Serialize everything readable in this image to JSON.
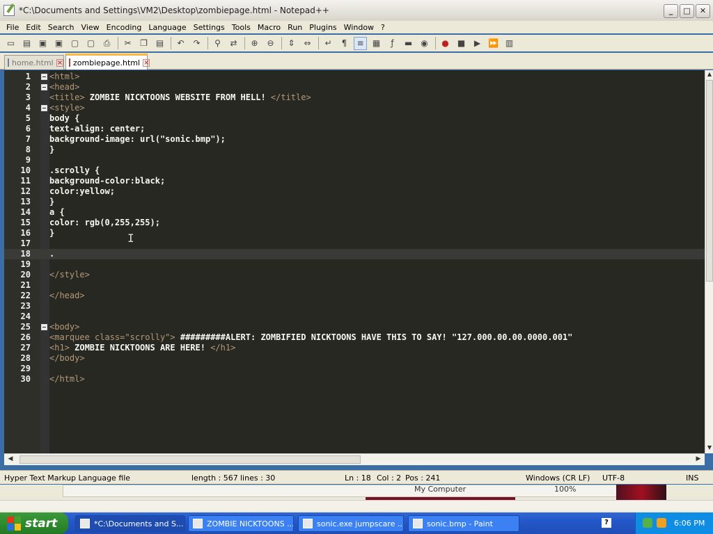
{
  "window": {
    "title": "*C:\\Documents and Settings\\VM2\\Desktop\\zombiepage.html - Notepad++"
  },
  "menu": [
    "File",
    "Edit",
    "Search",
    "View",
    "Encoding",
    "Language",
    "Settings",
    "Tools",
    "Macro",
    "Run",
    "Plugins",
    "Window",
    "?"
  ],
  "toolbar": {
    "icons": [
      "new-file-icon",
      "open-file-icon",
      "save-icon",
      "save-all-icon",
      "close-icon",
      "close-all-icon",
      "print-icon",
      "cut-icon",
      "copy-icon",
      "paste-icon",
      "undo-icon",
      "redo-icon",
      "find-icon",
      "replace-icon",
      "zoom-in-icon",
      "zoom-out-icon",
      "sync-vertical-icon",
      "sync-horizontal-icon",
      "word-wrap-icon",
      "show-all-chars-icon",
      "indent-guide-icon",
      "doc-map-icon",
      "function-list-icon",
      "folder-as-workspace-icon",
      "monitoring-icon",
      "record-macro-icon",
      "stop-macro-icon",
      "play-macro-icon",
      "run-macro-multiple-icon",
      "save-macro-icon"
    ]
  },
  "tabs": [
    {
      "label": "home.html",
      "active": false
    },
    {
      "label": "zombiepage.html",
      "active": true
    }
  ],
  "editor": {
    "current_line": 18,
    "lines": [
      {
        "n": "1",
        "fold": true,
        "parts": [
          [
            "tag",
            "<html>"
          ]
        ]
      },
      {
        "n": "2",
        "fold": true,
        "parts": [
          [
            "tag",
            "<head>"
          ]
        ]
      },
      {
        "n": "3",
        "fold": false,
        "parts": [
          [
            "tag",
            "<title>"
          ],
          [
            "txt",
            " ZOMBIE NICKTOONS WEBSITE FROM HELL! "
          ],
          [
            "tag",
            "</title>"
          ]
        ]
      },
      {
        "n": "4",
        "fold": true,
        "parts": [
          [
            "tag",
            "<style>"
          ]
        ]
      },
      {
        "n": "5",
        "fold": false,
        "parts": [
          [
            "txt",
            "body {"
          ]
        ]
      },
      {
        "n": "6",
        "fold": false,
        "parts": [
          [
            "txt",
            "text-align: center;"
          ]
        ]
      },
      {
        "n": "7",
        "fold": false,
        "parts": [
          [
            "txt",
            "background-image: url(\"sonic.bmp\");"
          ]
        ]
      },
      {
        "n": "8",
        "fold": false,
        "parts": [
          [
            "txt",
            "}"
          ]
        ]
      },
      {
        "n": "9",
        "fold": false,
        "parts": []
      },
      {
        "n": "10",
        "fold": false,
        "parts": [
          [
            "txt",
            ".scrolly {"
          ]
        ]
      },
      {
        "n": "11",
        "fold": false,
        "parts": [
          [
            "txt",
            "background-color:black;"
          ]
        ]
      },
      {
        "n": "12",
        "fold": false,
        "parts": [
          [
            "txt",
            "color:yellow;"
          ]
        ]
      },
      {
        "n": "13",
        "fold": false,
        "parts": [
          [
            "txt",
            "}"
          ]
        ]
      },
      {
        "n": "14",
        "fold": false,
        "parts": [
          [
            "txt",
            "a {"
          ]
        ]
      },
      {
        "n": "15",
        "fold": false,
        "parts": [
          [
            "txt",
            "color: rgb(0,255,255);"
          ]
        ]
      },
      {
        "n": "16",
        "fold": false,
        "parts": [
          [
            "txt",
            "}"
          ]
        ]
      },
      {
        "n": "17",
        "fold": false,
        "parts": []
      },
      {
        "n": "18",
        "fold": false,
        "parts": [
          [
            "txt",
            "."
          ]
        ]
      },
      {
        "n": "19",
        "fold": false,
        "parts": []
      },
      {
        "n": "20",
        "fold": false,
        "parts": [
          [
            "tag",
            "</style>"
          ]
        ]
      },
      {
        "n": "21",
        "fold": false,
        "parts": []
      },
      {
        "n": "22",
        "fold": false,
        "parts": [
          [
            "tag",
            "</head>"
          ]
        ]
      },
      {
        "n": "23",
        "fold": false,
        "parts": []
      },
      {
        "n": "24",
        "fold": false,
        "parts": []
      },
      {
        "n": "25",
        "fold": true,
        "parts": [
          [
            "tag",
            "<body>"
          ]
        ]
      },
      {
        "n": "26",
        "fold": false,
        "parts": [
          [
            "tag",
            "<marquee class=\"scrolly\">"
          ],
          [
            "txt",
            " #########ALERT: ZOMBIFIED NICKTOONS HAVE THIS TO SAY! \"127.000.00.00.0000.001\""
          ]
        ]
      },
      {
        "n": "27",
        "fold": false,
        "parts": [
          [
            "tag",
            "<h1>"
          ],
          [
            "txt",
            " ZOMBIE NICKTOONS ARE HERE! "
          ],
          [
            "tag",
            "</h1>"
          ]
        ]
      },
      {
        "n": "28",
        "fold": false,
        "parts": [
          [
            "tag",
            "</body>"
          ]
        ]
      },
      {
        "n": "29",
        "fold": false,
        "parts": []
      },
      {
        "n": "30",
        "fold": false,
        "parts": [
          [
            "tag",
            "</html>"
          ]
        ]
      }
    ]
  },
  "status": {
    "filetype": "Hyper Text Markup Language file",
    "length": "length : 567",
    "lines": "lines : 30",
    "ln": "Ln : 18",
    "col": "Col : 2",
    "pos": "Pos : 241",
    "eol": "Windows (CR LF)",
    "encoding": "UTF-8",
    "mode": "INS"
  },
  "background_window": {
    "my_computer": "My Computer",
    "zoom": "100%"
  },
  "taskbar": {
    "start_label": "start",
    "tasks": [
      {
        "label": "*C:\\Documents and S...",
        "active": true
      },
      {
        "label": "ZOMBIE NICKTOONS ...",
        "active": false
      },
      {
        "label": "sonic.exe jumpscare ...",
        "active": false
      },
      {
        "label": "sonic.bmp - Paint",
        "active": false
      }
    ],
    "clock": "6:06 PM"
  },
  "colors": {
    "editor_bg": "#272822",
    "tag": "#b6987a",
    "text": "#f8f8f2",
    "active_tab_accent": "#fab840"
  }
}
